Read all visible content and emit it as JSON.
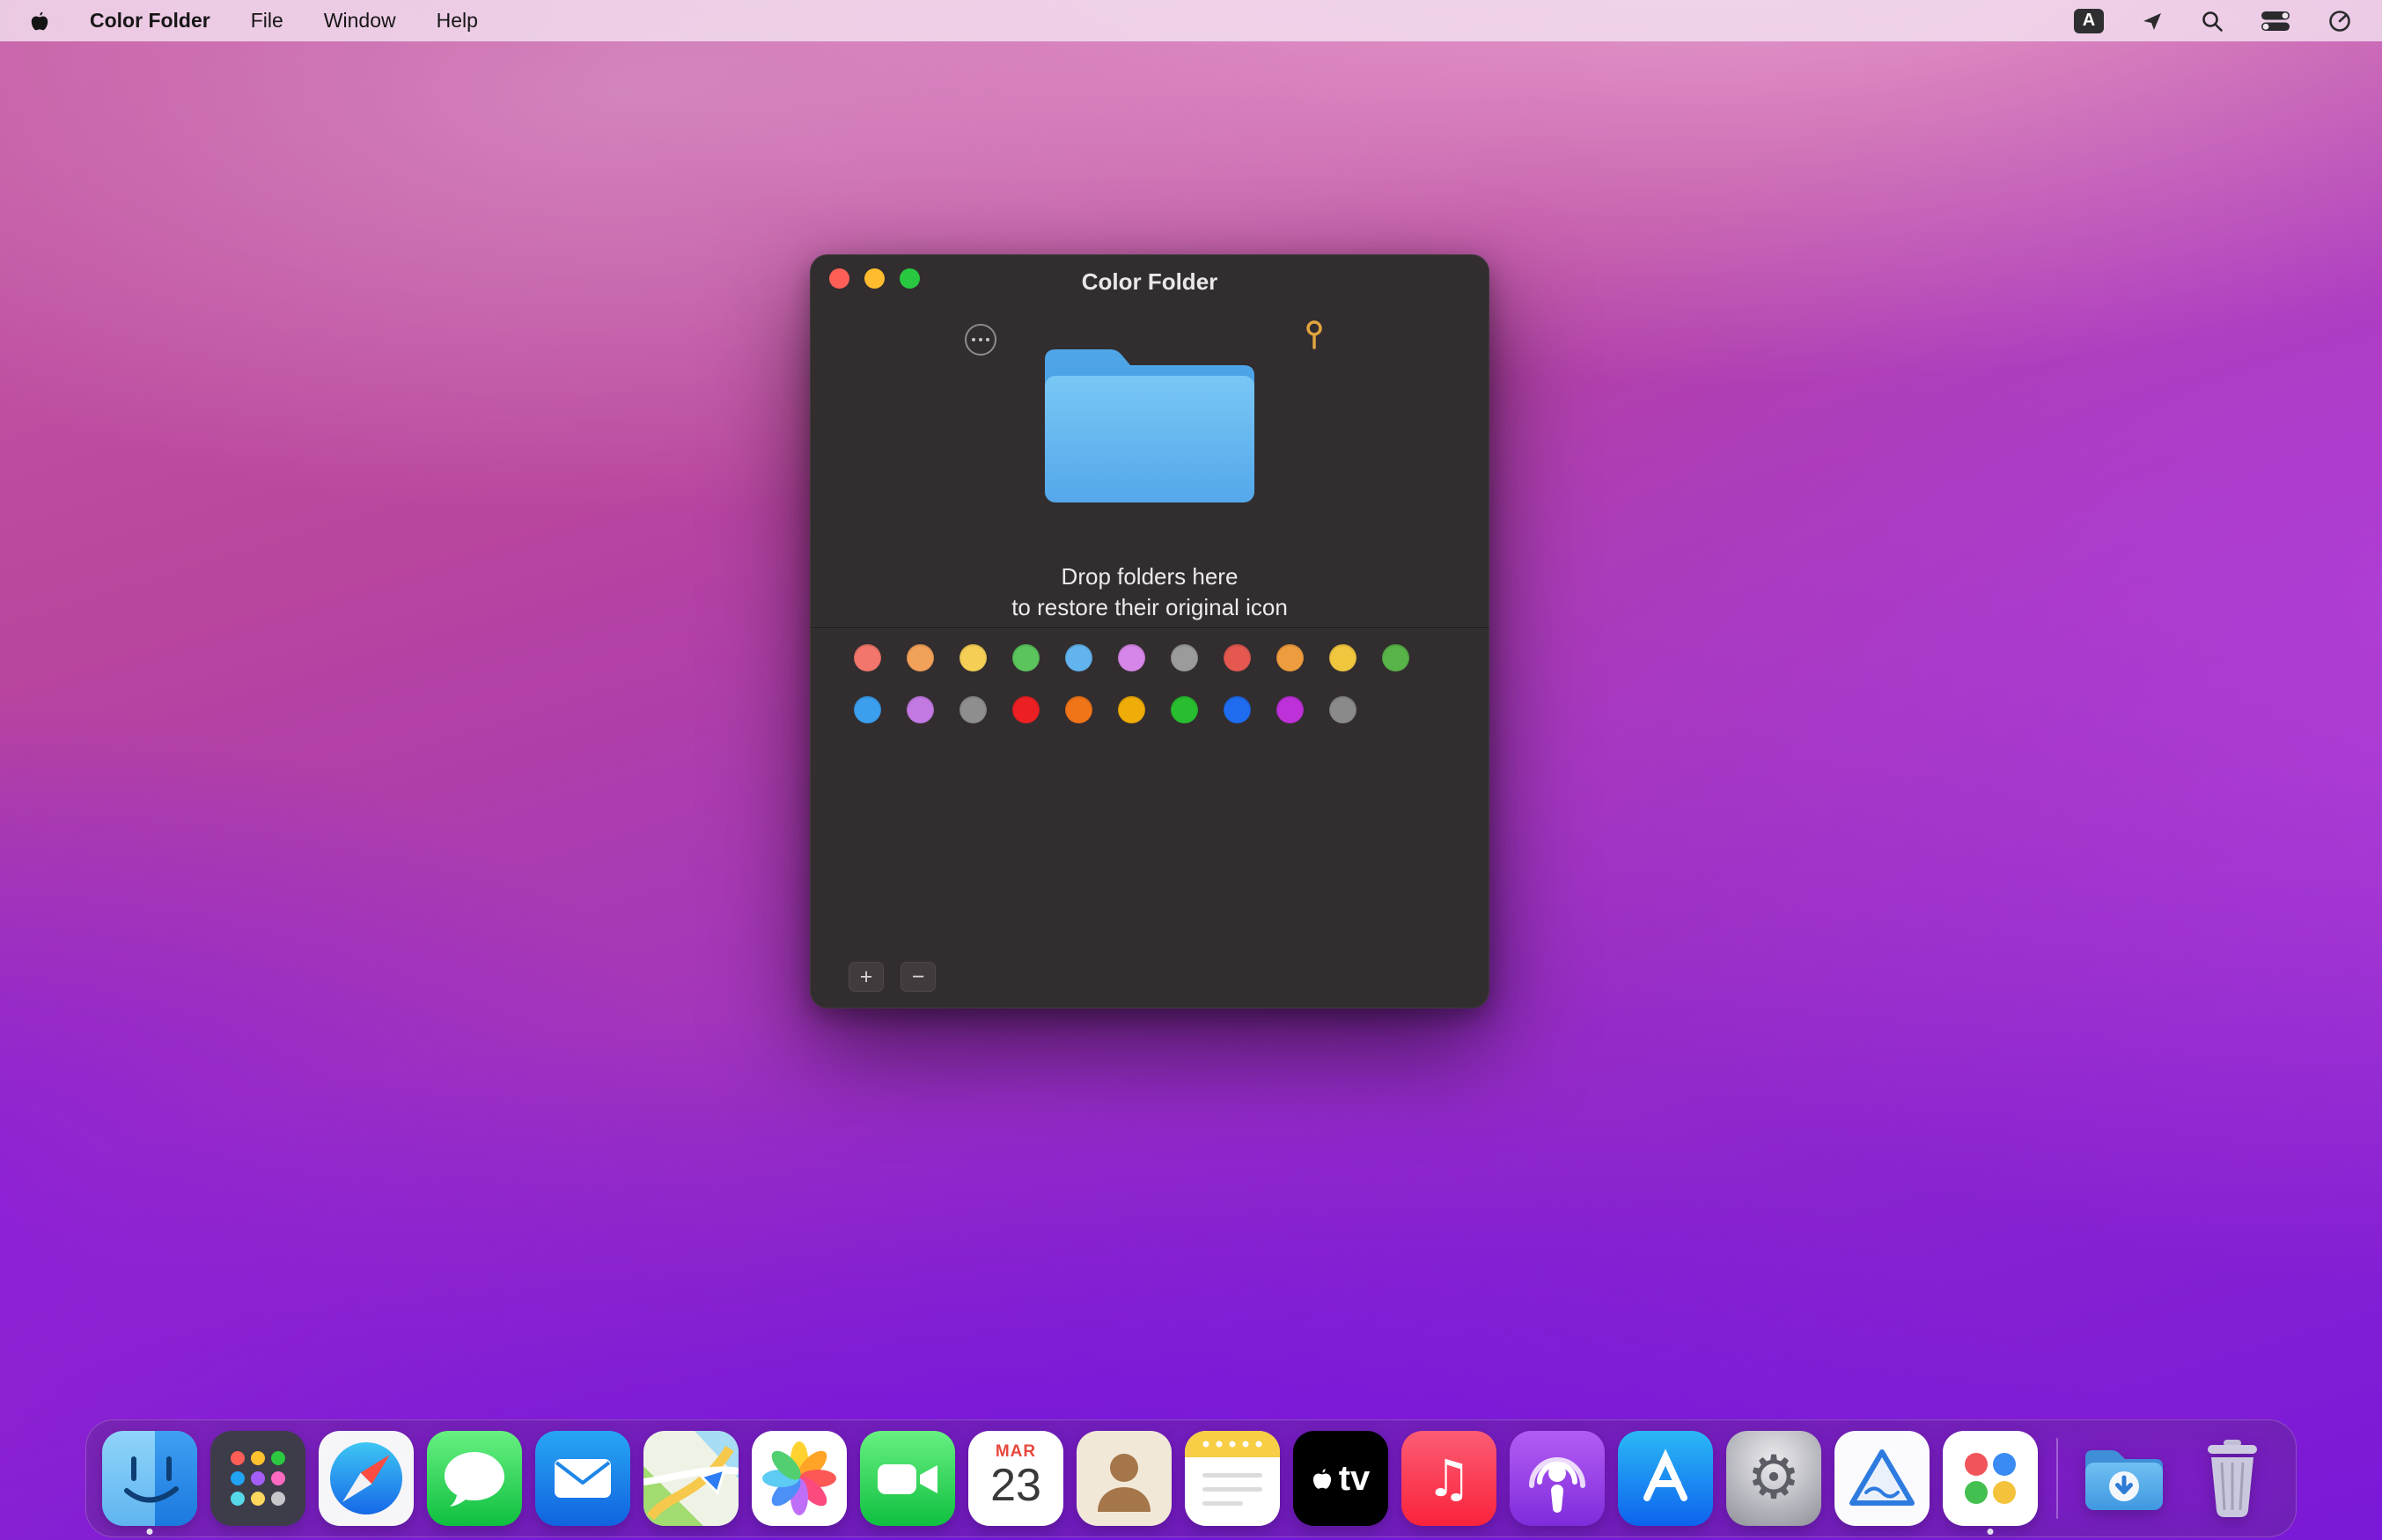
{
  "menu_bar": {
    "app_name": "Color Folder",
    "menus": [
      "File",
      "Window",
      "Help"
    ],
    "input_source_label": "A",
    "status_icons": [
      "input-source",
      "location-arrow",
      "spotlight-search",
      "control-center",
      "menu-extra-circle"
    ]
  },
  "window": {
    "title": "Color Folder",
    "drop_hint_line1": "Drop folders here",
    "drop_hint_line2": "to restore their original icon",
    "add_button_label": "+",
    "remove_button_label": "−",
    "swatch_rows": [
      [
        "#F2766B",
        "#F2A158",
        "#F5CF55",
        "#5CC45C",
        "#62B4EE",
        "#D686E8",
        "#9B9B9B",
        "#E45850",
        "#EE9D3E",
        "#F0C63E",
        "#58B348"
      ],
      [
        "#3B9FEE",
        "#C279E2",
        "#8E8E8E",
        "#EC2024",
        "#F07519",
        "#F0AD07",
        "#28BE30",
        "#1F6CF0",
        "#BE30D8",
        "#8A8A8A"
      ]
    ]
  },
  "dock": {
    "items": [
      "finder",
      "launchpad",
      "safari",
      "messages",
      "mail",
      "maps",
      "photos",
      "facetime",
      "calendar",
      "contacts",
      "notes",
      "apple-tv",
      "music",
      "podcasts",
      "app-store",
      "system-settings",
      "prism-app",
      "color-folder-app",
      "downloads-folder",
      "trash"
    ],
    "running_items": [
      "finder",
      "color-folder-app"
    ],
    "calendar_month": "MAR",
    "calendar_day": "23",
    "tv_label": "tv",
    "music_note_glyph": "♫",
    "gear_glyph": "⚙"
  },
  "colors": {
    "traffic_red": "#FF5F57",
    "traffic_yellow": "#FEBC2E",
    "traffic_green": "#28C840",
    "window_background": "#322D2F",
    "folder_blue_top": "#79C7F5",
    "folder_blue_bottom": "#54A8EA"
  }
}
